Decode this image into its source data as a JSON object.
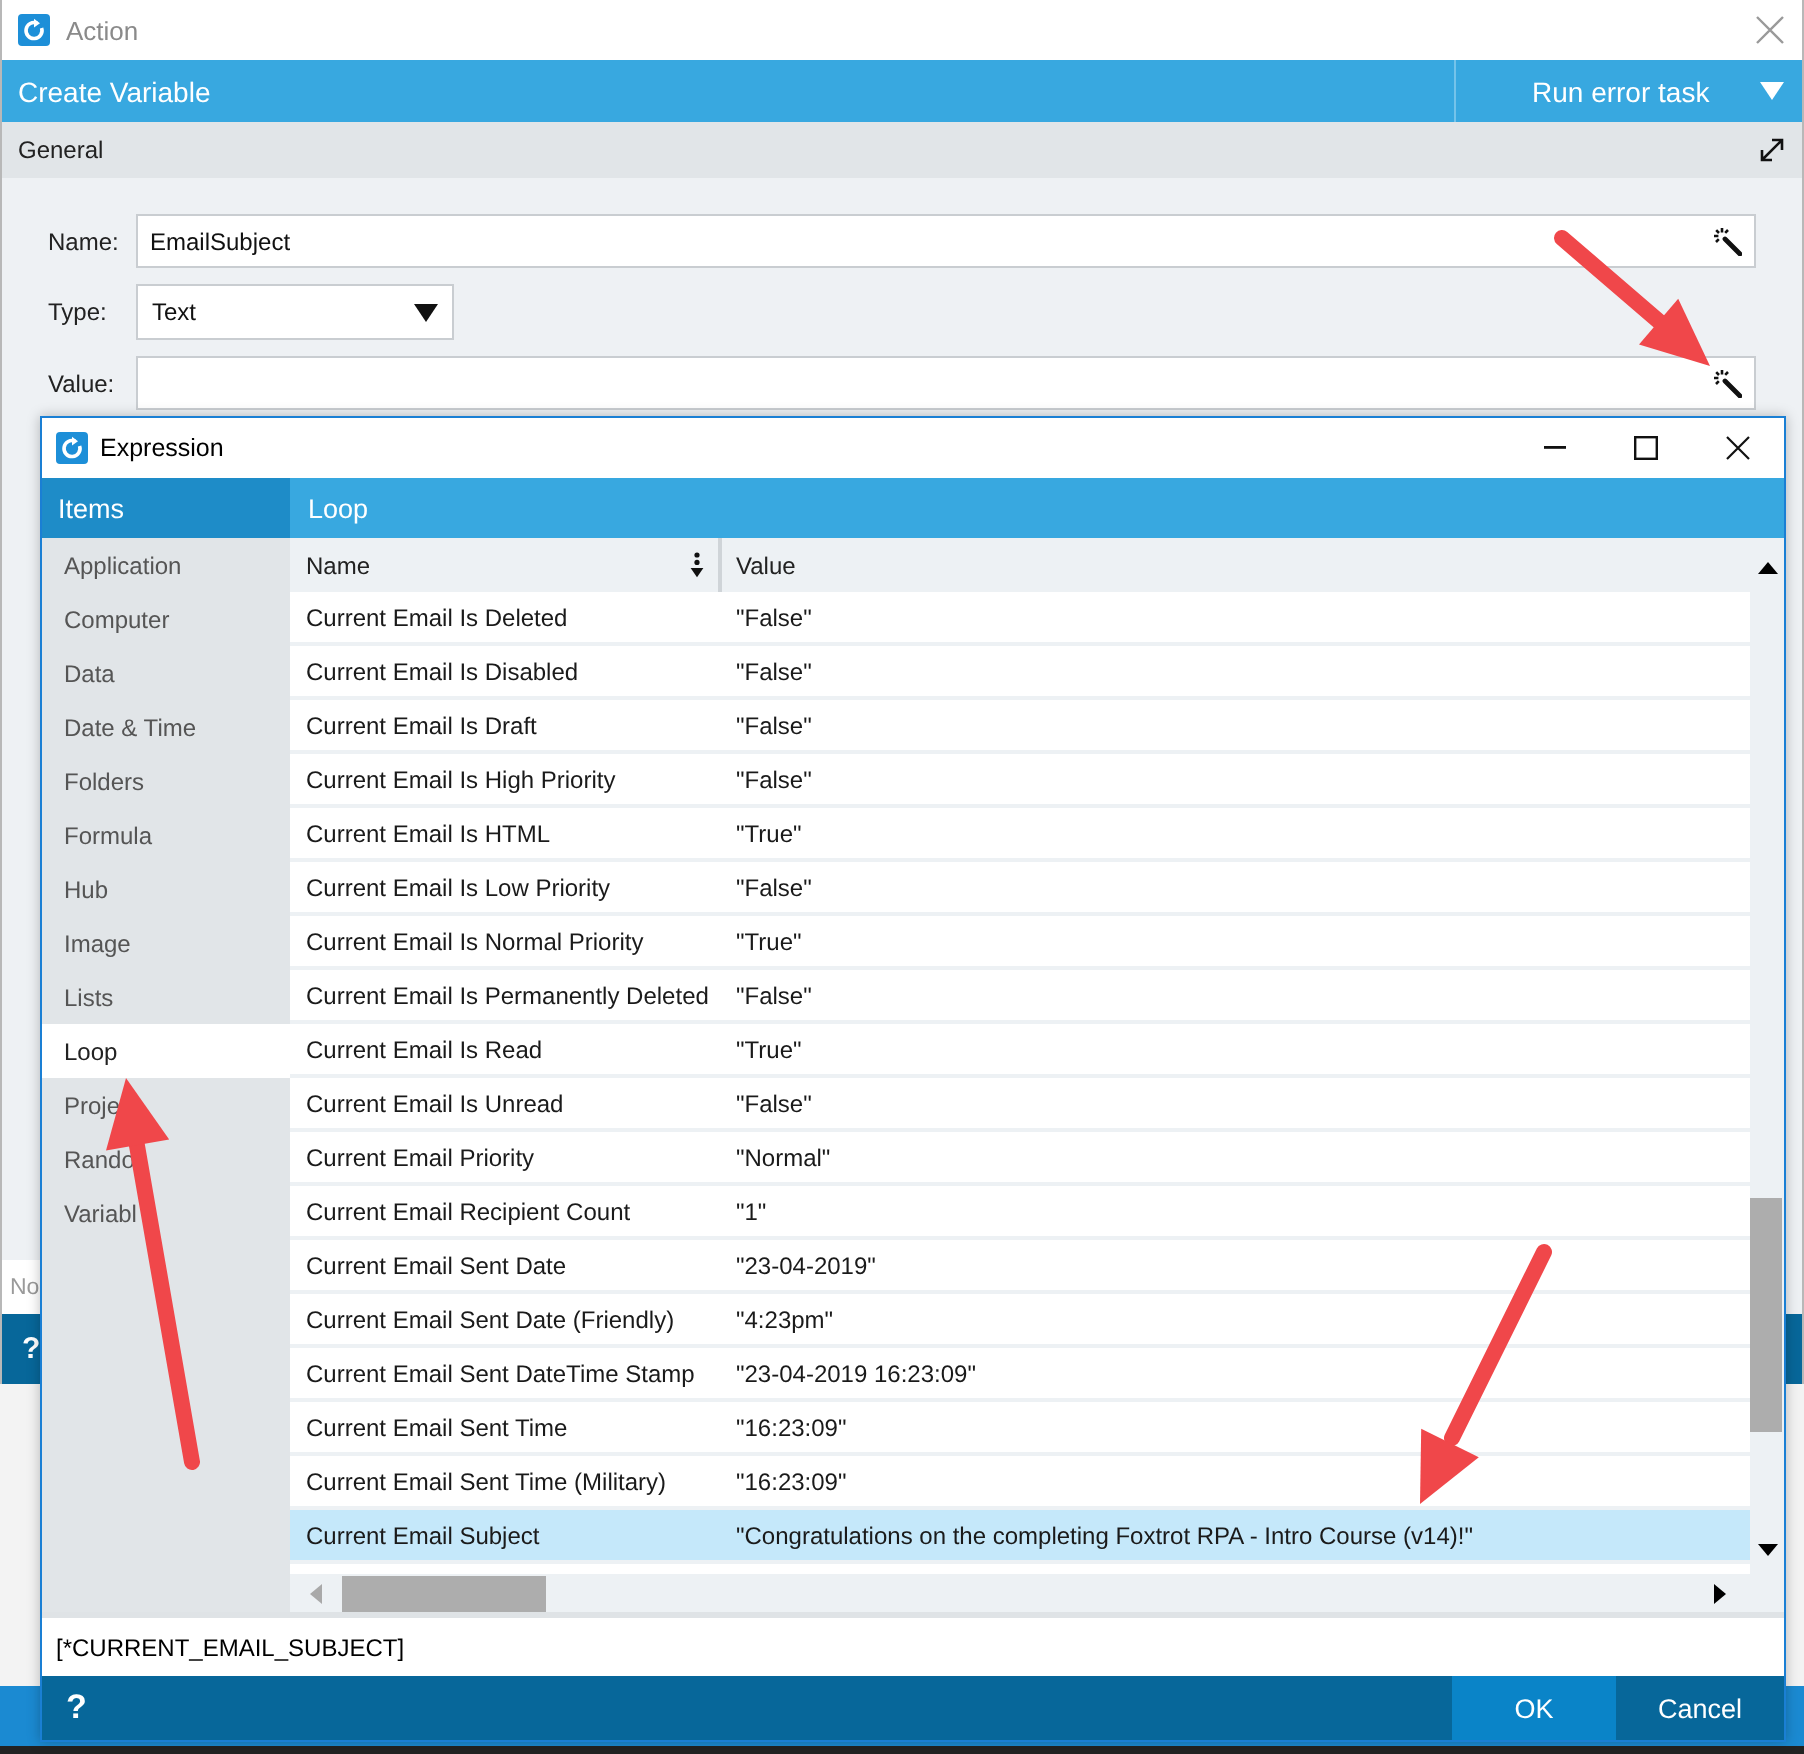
{
  "action_window": {
    "title": "Action",
    "header": {
      "title": "Create Variable",
      "error_menu": "Run error task"
    },
    "section": "General",
    "fields": [
      {
        "label": "Name:",
        "kind": "text",
        "value": "EmailSubject"
      },
      {
        "label": "Type:",
        "kind": "dropdown",
        "value": "Text"
      },
      {
        "label": "Value:",
        "kind": "text"
      }
    ],
    "notes_field": {
      "placeholder": "No"
    },
    "help": "?"
  },
  "expression_window": {
    "title": "Expression",
    "sidebar": {
      "title": "Items",
      "items": [
        {
          "label": "Application",
          "selected": false
        },
        {
          "label": "Computer",
          "selected": false
        },
        {
          "label": "Data",
          "selected": false
        },
        {
          "label": "Date & Time",
          "selected": false
        },
        {
          "label": "Folders",
          "selected": false
        },
        {
          "label": "Formula",
          "selected": false
        },
        {
          "label": "Hub",
          "selected": false
        },
        {
          "label": "Image",
          "selected": false
        },
        {
          "label": "Lists",
          "selected": false
        },
        {
          "label": "Loop",
          "selected": true
        },
        {
          "label": "Proje",
          "selected": false
        },
        {
          "label": "Rando",
          "selected": false
        },
        {
          "label": "Variabl",
          "selected": false
        }
      ]
    },
    "panel_title": "Loop",
    "table": {
      "columns": [
        "Name",
        "Value"
      ],
      "rows": [
        {
          "name": "Current Email Is Deleted",
          "value": "\"False\"",
          "selected": false
        },
        {
          "name": "Current Email Is Disabled",
          "value": "\"False\"",
          "selected": false
        },
        {
          "name": "Current Email Is Draft",
          "value": "\"False\"",
          "selected": false
        },
        {
          "name": "Current Email Is High Priority",
          "value": "\"False\"",
          "selected": false
        },
        {
          "name": "Current Email Is HTML",
          "value": "\"True\"",
          "selected": false
        },
        {
          "name": "Current Email Is Low Priority",
          "value": "\"False\"",
          "selected": false
        },
        {
          "name": "Current Email Is Normal Priority",
          "value": "\"True\"",
          "selected": false
        },
        {
          "name": "Current Email Is Permanently Deleted",
          "value": "\"False\"",
          "selected": false
        },
        {
          "name": "Current Email Is Read",
          "value": "\"True\"",
          "selected": false
        },
        {
          "name": "Current Email Is Unread",
          "value": "\"False\"",
          "selected": false
        },
        {
          "name": "Current Email Priority",
          "value": "\"Normal\"",
          "selected": false
        },
        {
          "name": "Current Email Recipient Count",
          "value": "\"1\"",
          "selected": false
        },
        {
          "name": "Current Email Sent Date",
          "value": "\"23-04-2019\"",
          "selected": false
        },
        {
          "name": "Current Email Sent Date (Friendly)",
          "value": "\"4:23pm\"",
          "selected": false
        },
        {
          "name": "Current Email Sent DateTime Stamp",
          "value": "\"23-04-2019 16:23:09\"",
          "selected": false
        },
        {
          "name": "Current Email Sent Time",
          "value": "\"16:23:09\"",
          "selected": false
        },
        {
          "name": "Current Email Sent Time (Military)",
          "value": "\"16:23:09\"",
          "selected": false
        },
        {
          "name": "Current Email Subject",
          "value": "\"Congratulations on the completing Foxtrot RPA - Intro Course (v14)!\"",
          "selected": true
        }
      ]
    },
    "expression": {
      "value": "[*CURRENT_EMAIL_SUBJECT]"
    },
    "help": "?",
    "buttons": [
      {
        "label": "OK",
        "kind": "primary"
      },
      {
        "label": "Cancel",
        "kind": "secondary"
      }
    ]
  }
}
